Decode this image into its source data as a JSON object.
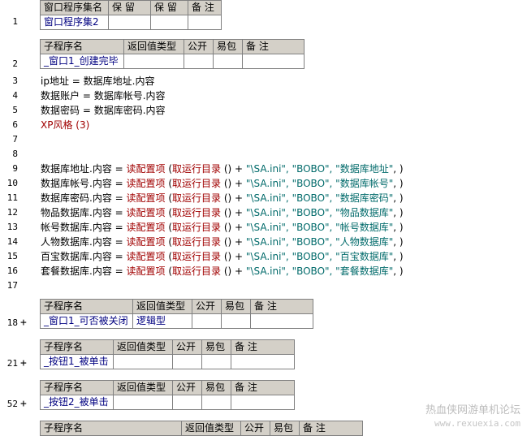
{
  "window_table": {
    "headers": [
      "窗口程序集名",
      "保 留",
      "保 留",
      "备 注"
    ],
    "values": [
      "窗口程序集2",
      "",
      "",
      ""
    ]
  },
  "sub1": {
    "headers": [
      "子程序名",
      "返回值类型",
      "公开",
      "易包",
      "备 注"
    ],
    "values": [
      "_窗口1_创建完毕",
      "",
      "",
      "",
      ""
    ]
  },
  "code_lines": {
    "l3": {
      "lhs": "ip地址",
      "eq": " = ",
      "rhs": "数据库地址.内容"
    },
    "l4": {
      "lhs": "数据账户",
      "eq": " = ",
      "rhs": "数据库帐号.内容"
    },
    "l5": {
      "lhs": "数据密码",
      "eq": " = ",
      "rhs": "数据库密码.内容"
    },
    "l6": {
      "text": "XP风格 (3)"
    }
  },
  "config_lines": [
    {
      "target": "数据库地址.内容",
      "section": "\"数据库地址\""
    },
    {
      "target": "数据库帐号.内容",
      "section": "\"数据库帐号\""
    },
    {
      "target": "数据库密码.内容",
      "section": "\"数据库密码\""
    },
    {
      "target": "物品数据库.内容",
      "section": "\"物品数据库\""
    },
    {
      "target": "帐号数据库.内容",
      "section": "\"帐号数据库\""
    },
    {
      "target": "人物数据库.内容",
      "section": "\"人物数据库\""
    },
    {
      "target": "百宝数据库.内容",
      "section": "\"百宝数据库\""
    },
    {
      "target": "套餐数据库.内容",
      "section": "\"套餐数据库\""
    }
  ],
  "config_common": {
    "eq": " = ",
    "fn": "读配置项",
    "open": " (",
    "inner_fn": "取运行目录",
    "inner_call": " () ",
    "plus": "+",
    "file": " \"\\SA.ini\", ",
    "key": "\"BOBO\", ",
    "close": ", )"
  },
  "sub2": {
    "headers": [
      "子程序名",
      "返回值类型",
      "公开",
      "易包",
      "备 注"
    ],
    "values": [
      "_窗口1_可否被关闭",
      "逻辑型",
      "",
      "",
      ""
    ]
  },
  "sub3": {
    "headers": [
      "子程序名",
      "返回值类型",
      "公开",
      "易包",
      "备 注"
    ],
    "values": [
      "_按钮1_被单击",
      "",
      "",
      "",
      ""
    ]
  },
  "sub4": {
    "headers": [
      "子程序名",
      "返回值类型",
      "公开",
      "易包",
      "备 注"
    ],
    "values": [
      "_按钮2_被单击",
      "",
      "",
      "",
      ""
    ]
  },
  "sub5": {
    "headers": [
      "子程序名",
      "返回值类型",
      "公开",
      "易包",
      "备 注"
    ]
  },
  "line_numbers": {
    "n1": "1",
    "n2": "2",
    "n3": "3",
    "n4": "4",
    "n5": "5",
    "n6": "6",
    "n7": "7",
    "n8": "8",
    "n9": "9",
    "n10": "10",
    "n11": "11",
    "n12": "12",
    "n13": "13",
    "n14": "14",
    "n15": "15",
    "n16": "16",
    "n17": "17",
    "n18": "18",
    "n21": "21",
    "n52": "52"
  },
  "fold_glyph": "+",
  "watermark": {
    "line1": "热血侠网游单机论坛",
    "line2": "www.rexuexia.com"
  },
  "colors": {
    "header_bg": "#d4d0c8",
    "keyword_red": "#a00000",
    "string_teal": "#006a6a",
    "name_blue": "#000080"
  }
}
